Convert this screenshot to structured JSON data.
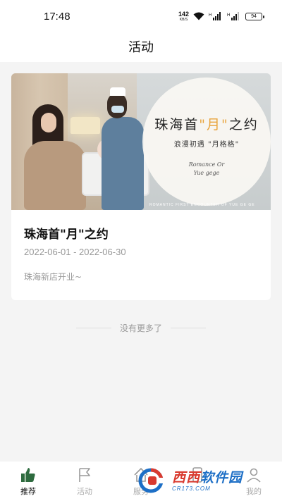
{
  "status_bar": {
    "time": "17:48",
    "net_speed": "142",
    "net_unit": "KB/S",
    "battery": "94"
  },
  "header": {
    "title": "活动"
  },
  "activity": {
    "banner": {
      "title_prefix": "珠海首",
      "title_accent": "\"月\"",
      "title_suffix": "之约",
      "subtitle": "浪漫初遇 \"月格格\"",
      "script_line1": "Romance Or",
      "script_line2": "Yue gege",
      "tagline": "ROMANTIC FIRST ENCOUNTER OF YUE GE GE"
    },
    "title": "珠海首\"月\"之约",
    "date_range": "2022-06-01 - 2022-06-30",
    "description": "珠海新店开业~"
  },
  "list_footer": "没有更多了",
  "bottom_nav": {
    "items": [
      {
        "label": "推荐",
        "icon": "thumbs-up-icon",
        "active": true
      },
      {
        "label": "活动",
        "icon": "flag-icon",
        "active": false
      },
      {
        "label": "服务",
        "icon": "service-icon",
        "active": false
      },
      {
        "label": "",
        "icon": "phone-icon",
        "active": false
      },
      {
        "label": "我的",
        "icon": "user-icon",
        "active": false
      }
    ]
  },
  "watermark": {
    "brand_red": "西西",
    "brand_blue": "软件园",
    "url": "CR173.COM"
  },
  "colors": {
    "accent_gold": "#e8a33b",
    "brand_red": "#d93a2f",
    "brand_blue": "#1d6fc6",
    "active_icon_green": "#2e6b3f"
  }
}
